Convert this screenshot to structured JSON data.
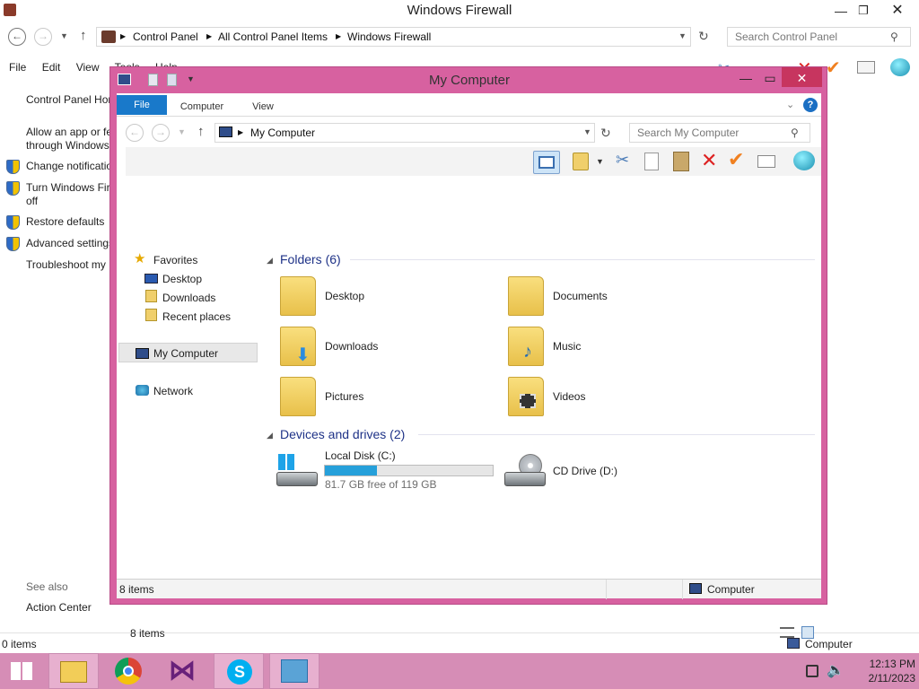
{
  "bg_window": {
    "title": "Windows Firewall",
    "breadcrumb": [
      "Control Panel",
      "All Control Panel Items",
      "Windows Firewall"
    ],
    "search_placeholder": "Search Control Panel",
    "menu": [
      "File",
      "Edit",
      "View",
      "Tools",
      "Help"
    ],
    "left_links": [
      "Control Panel Home",
      "Allow an app or feature",
      "through Windows Firewall",
      "Change notification settings",
      "Turn Windows Firewall on or",
      "off",
      "Restore defaults",
      "Advanced settings",
      "Troubleshoot my network"
    ],
    "see_also": "See also",
    "action_center": "Action Center",
    "status_left": "0 items",
    "status_right": "Computer"
  },
  "window": {
    "title": "My Computer",
    "tabs": [
      "File",
      "Computer",
      "View"
    ],
    "address": "My Computer",
    "search_placeholder": "Search My Computer",
    "sidebar": {
      "favorites": "Favorites",
      "favorites_items": [
        "Desktop",
        "Downloads",
        "Recent places"
      ],
      "my_computer": "My Computer",
      "network": "Network"
    },
    "folders_header": "Folders (6)",
    "folders": [
      "Desktop",
      "Documents",
      "Downloads",
      "Music",
      "Pictures",
      "Videos"
    ],
    "devices_header": "Devices and drives (2)",
    "drives": [
      {
        "name": "Local Disk (C:)",
        "free": "81.7 GB free of 119 GB",
        "used_fraction": 0.31
      },
      {
        "name": "CD Drive (D:)"
      }
    ],
    "items_count": "8 items",
    "status_items": "8 items",
    "status_location": "Computer"
  },
  "taskbar": {
    "time": "12:13 PM",
    "date": "2/11/2023"
  },
  "colors": {
    "window_frame": "#d761a0",
    "taskbar": "#d68db6",
    "file_tab": "#1979ca",
    "close_button": "#c7355f"
  }
}
